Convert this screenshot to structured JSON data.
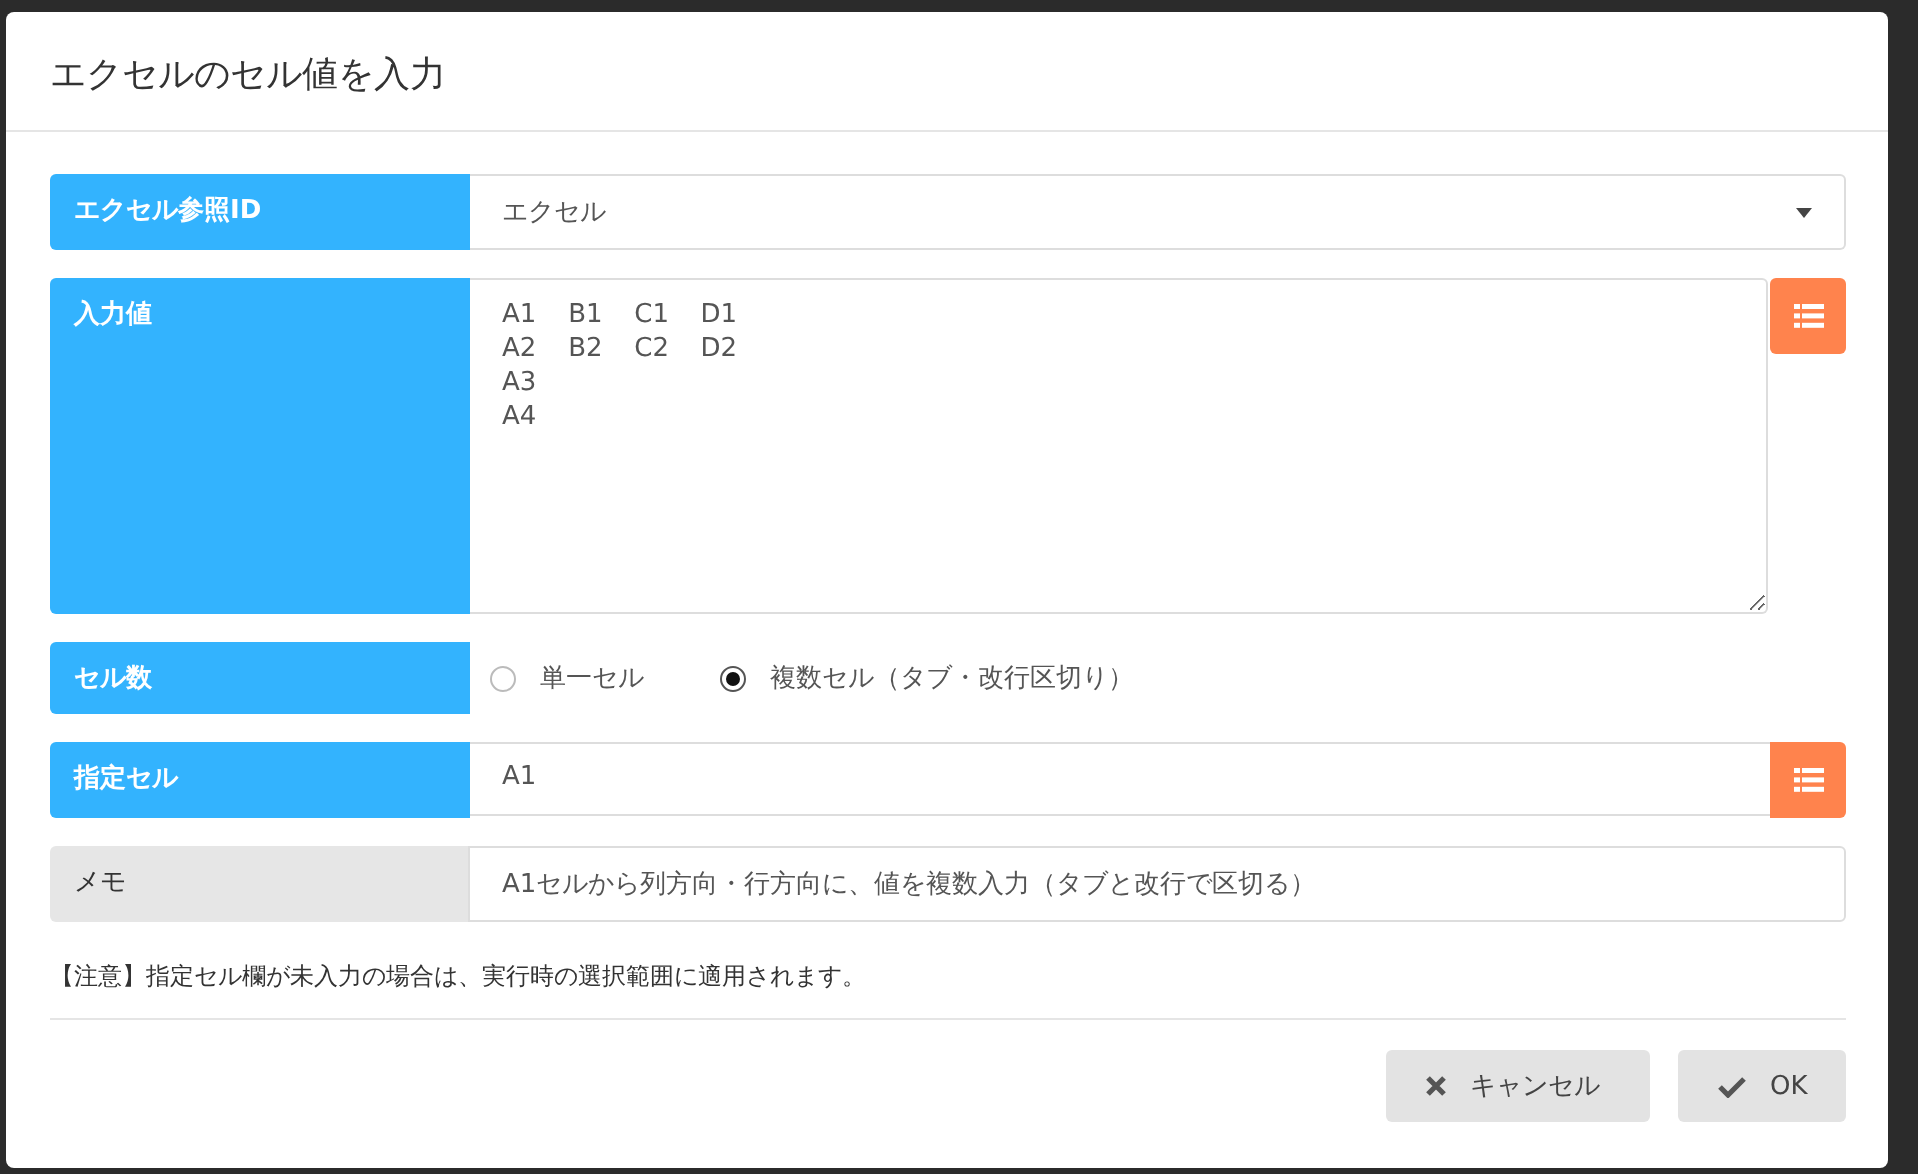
{
  "dialog": {
    "title": "エクセルのセル値を入力"
  },
  "rows": [
    {
      "kind": "select",
      "label": "エクセル参照ID",
      "value": "エクセル",
      "required": true
    },
    {
      "kind": "textarea",
      "label": "入力値",
      "value": "A1\tB1\tC1\tD1\nA2\tB2\tC2\tD2\nA3\nA4",
      "required": true,
      "picker": true
    },
    {
      "kind": "radio",
      "label": "セル数",
      "required": true,
      "options": [
        {
          "label": "単一セル",
          "selected": false
        },
        {
          "label": "複数セル（タブ・改行区切り）",
          "selected": true
        }
      ]
    },
    {
      "kind": "text",
      "label": "指定セル",
      "value": "A1",
      "required": true,
      "picker": true
    },
    {
      "kind": "memo",
      "label": "メモ",
      "value": "A1セルから列方向・行方向に、値を複数入力（タブと改行で区切る）",
      "required": false
    }
  ],
  "note": "【注意】指定セル欄が未入力の場合は、実行時の選択範囲に適用されます。",
  "buttons": [
    {
      "kind": "cancel",
      "label": "キャンセル"
    },
    {
      "kind": "ok",
      "label": "OK"
    }
  ]
}
